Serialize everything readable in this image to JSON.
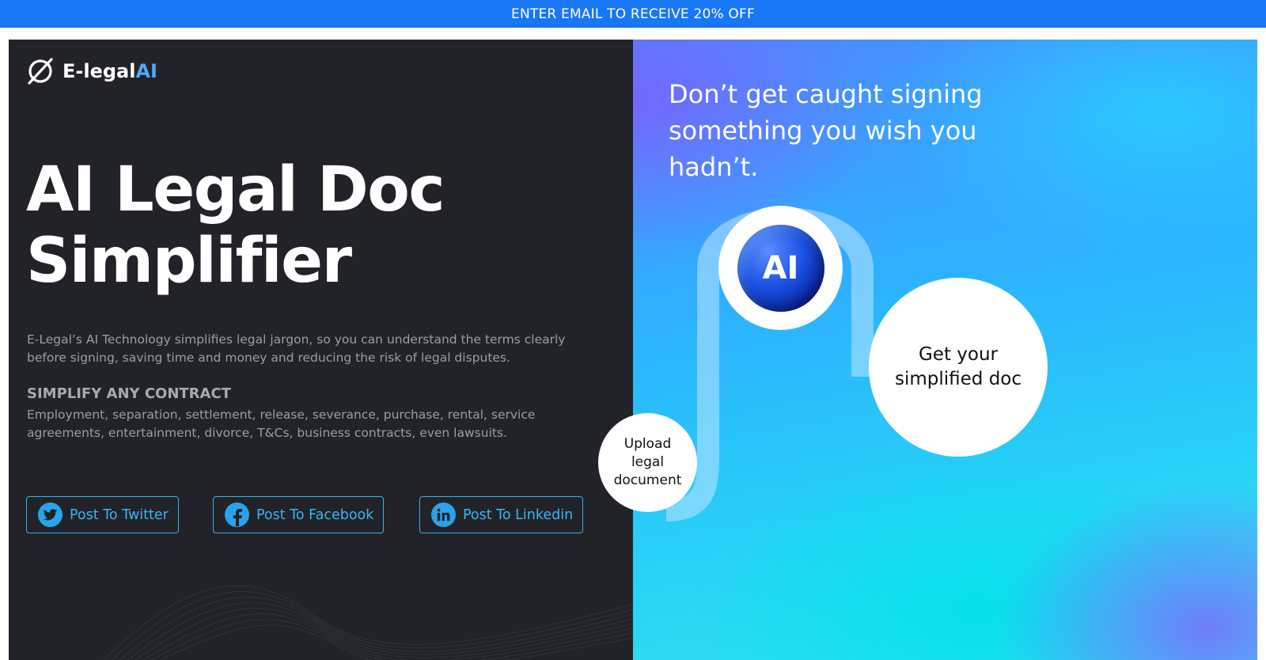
{
  "promo_bar": {
    "text": "ENTER EMAIL TO RECEIVE 20% OFF"
  },
  "brand": {
    "name_prefix": "E-legal",
    "name_suffix": "AI"
  },
  "hero": {
    "title_line1": "AI Legal Doc",
    "title_line2": "Simplifier",
    "description": "E-Legal’s AI Technology simplifies legal jargon, so you can understand the terms clearly before signing, saving time and money and reducing the risk of legal disputes.",
    "subheading": "SIMPLIFY ANY CONTRACT",
    "contract_types": "Employment, separation, settlement, release, severance, purchase, rental, service agreements, entertainment, divorce, T&Cs, business contracts, even lawsuits."
  },
  "share": {
    "twitter_label": "Post To Twitter",
    "facebook_label": "Post To Facebook",
    "linkedin_label": "Post To Linkedin"
  },
  "illustration": {
    "tagline": "Don’t get caught signing something you wish you hadn’t.",
    "ai_label": "AI",
    "step_upload": "Upload legal document",
    "step_result": "Get your simplified doc"
  },
  "colors": {
    "promo_bar": "#1877f7",
    "panel_dark": "#212328",
    "accent": "#3cb4f0",
    "brand_ai": "#4fa7ff"
  }
}
